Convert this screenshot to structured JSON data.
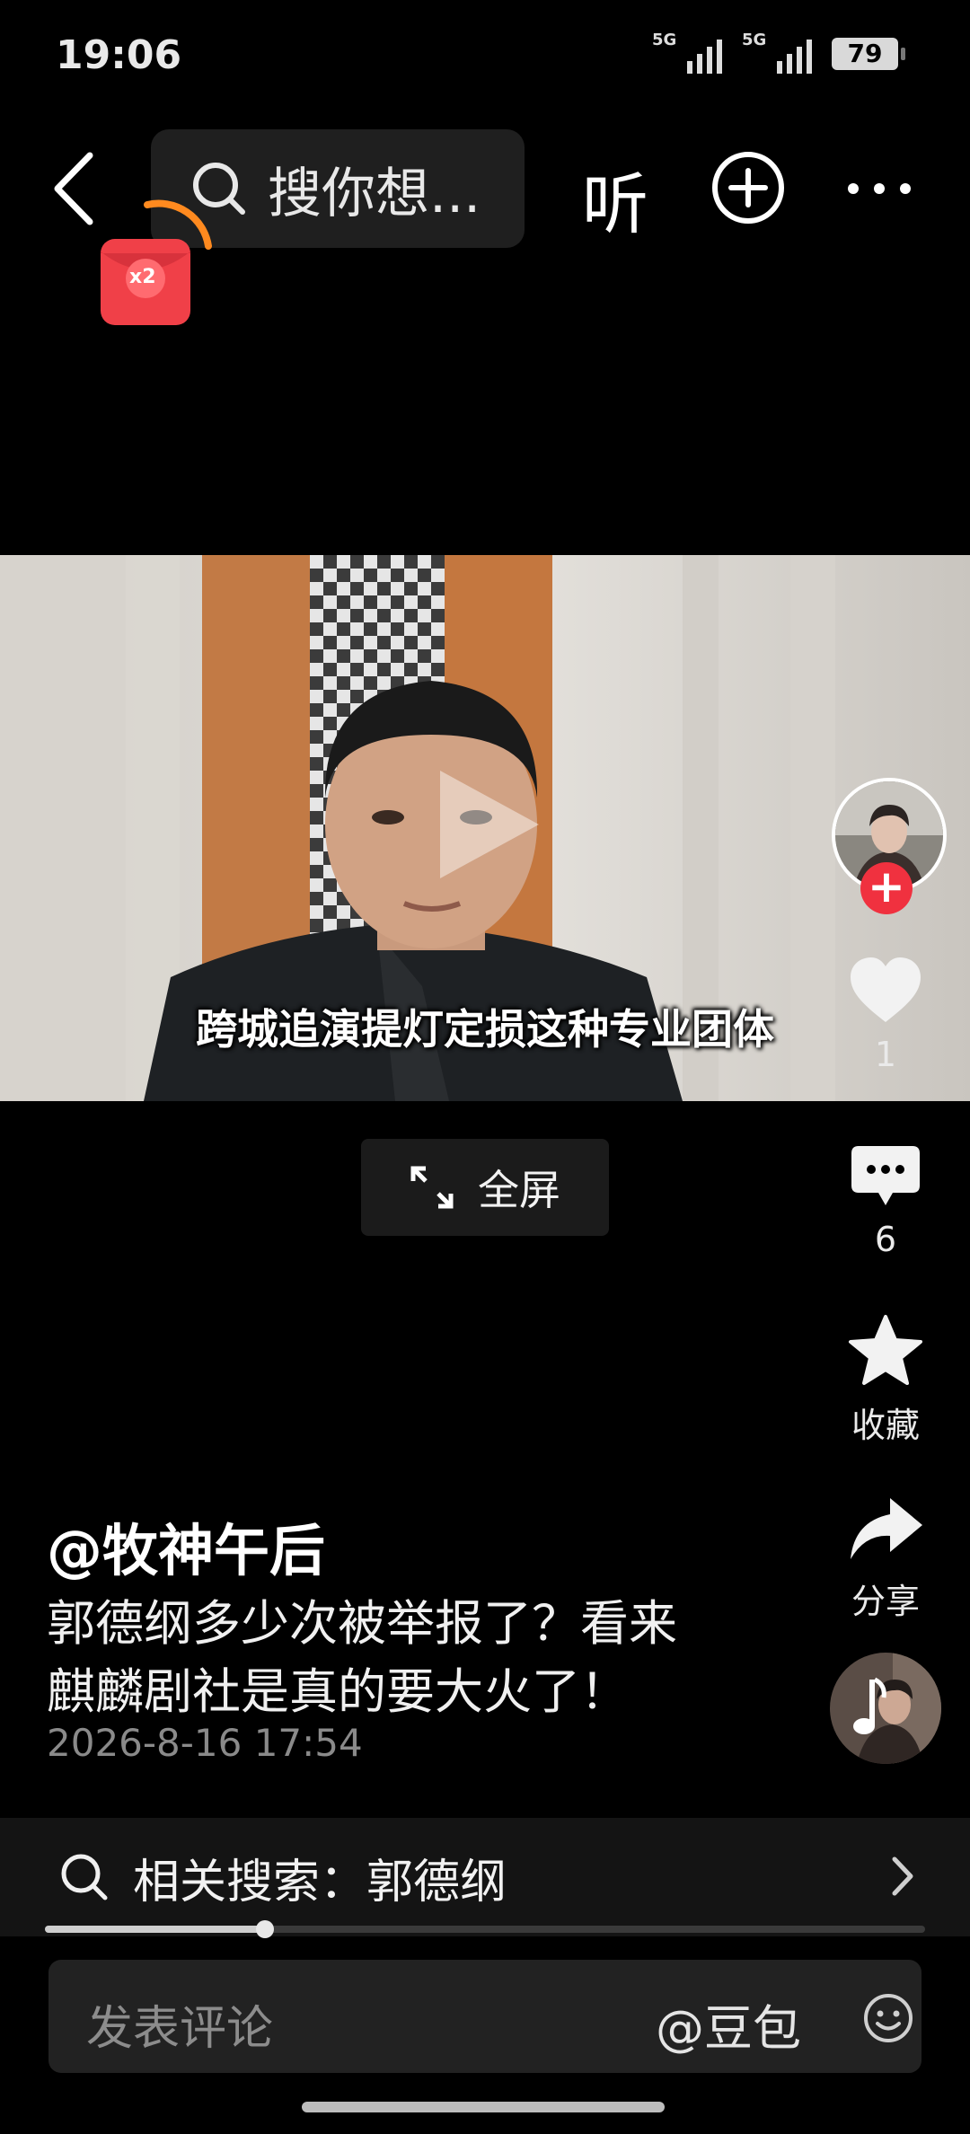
{
  "status_bar": {
    "time": "19:06",
    "signal1": "5G",
    "signal2": "5G",
    "battery": "79"
  },
  "nav": {
    "search_placeholder": "搜你想...",
    "listen_label": "听"
  },
  "red_packet": {
    "label": "x2"
  },
  "video": {
    "subtitle": "跨城追演提灯定损这种专业团体"
  },
  "fullscreen": {
    "label": "全屏"
  },
  "actions": {
    "like_count": "1",
    "comment_count": "6",
    "favorite_label": "收藏",
    "share_label": "分享"
  },
  "post": {
    "author": "@牧神午后",
    "description_line1": "郭德纲多少次被举报了？看来",
    "description_line2": "麒麟剧社是真的要大火了！",
    "date": "2026-8-16 17:54"
  },
  "related_search": {
    "label": "相关搜索：郭德纲"
  },
  "progress": {
    "fraction": 0.25
  },
  "comment": {
    "placeholder": "发表评论",
    "mention": "@豆包"
  },
  "colors": {
    "accent_red": "#f0313f",
    "background": "#000000"
  }
}
